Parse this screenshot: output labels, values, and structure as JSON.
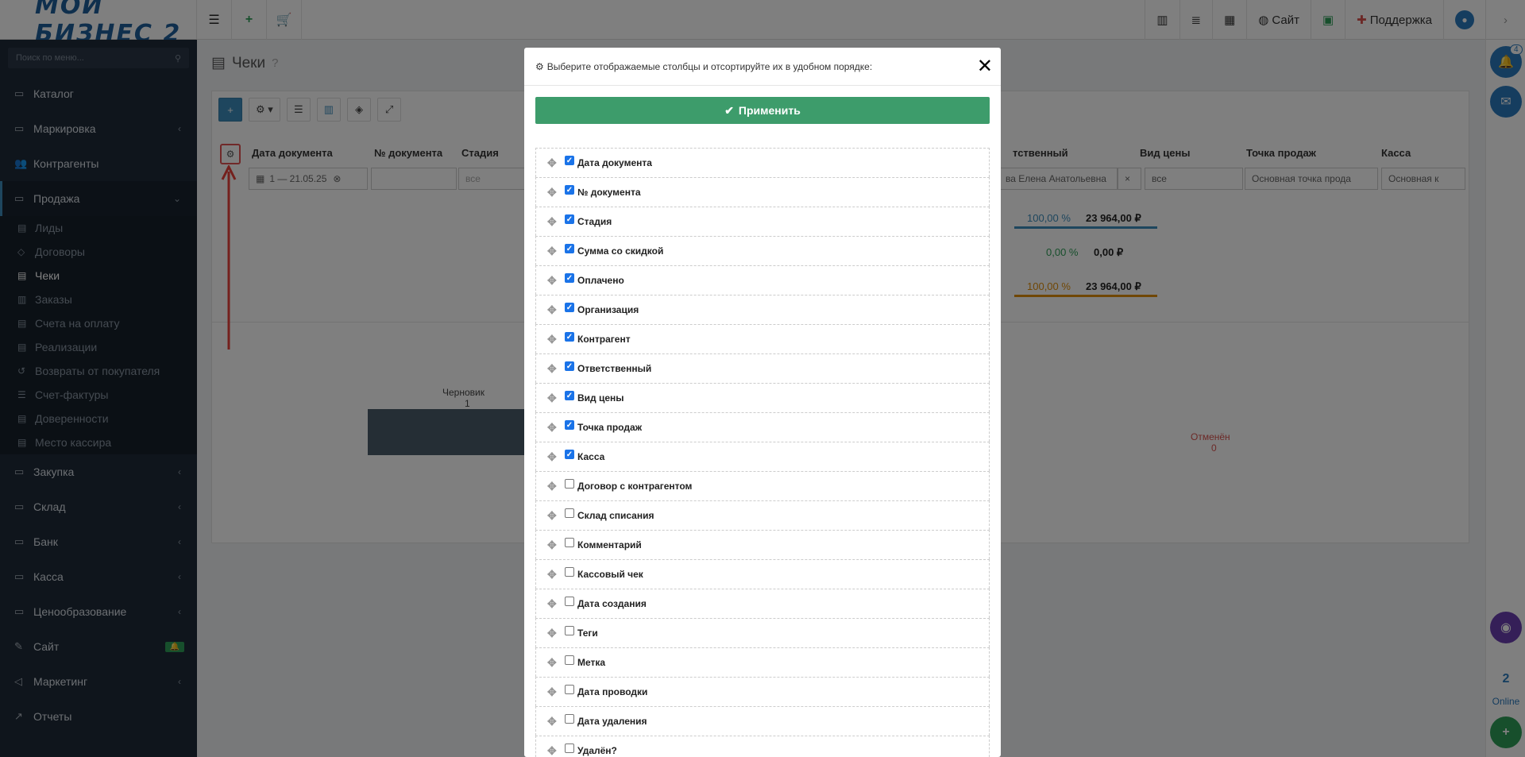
{
  "topbar": {
    "logo": "МОЙ БИЗНЕС 2",
    "site": "Сайт",
    "support": "Поддержка"
  },
  "sidebar": {
    "search_placeholder": "Поиск по меню...",
    "items": [
      {
        "label": "Каталог",
        "icon": "folder-icon",
        "chevron": false
      },
      {
        "label": "Маркировка",
        "icon": "folder-icon",
        "chevron": true
      },
      {
        "label": "Контрагенты",
        "icon": "users-icon",
        "chevron": false
      },
      {
        "label": "Продажа",
        "icon": "folder-icon",
        "chevron": true
      }
    ],
    "sub_items": [
      "Лиды",
      "Договоры",
      "Чеки",
      "Заказы",
      "Счета на оплату",
      "Реализации",
      "Возвраты от покупателя",
      "Счет-фактуры",
      "Доверенности",
      "Место кассира"
    ],
    "bottom_items": [
      {
        "label": "Закупка"
      },
      {
        "label": "Склад"
      },
      {
        "label": "Банк"
      },
      {
        "label": "Касса"
      },
      {
        "label": "Ценообразование"
      },
      {
        "label": "Сайт"
      },
      {
        "label": "Маркетинг"
      },
      {
        "label": "Отчеты"
      }
    ]
  },
  "content": {
    "page_title": "Чеки",
    "columns": {
      "date": "Дата документа",
      "number": "№ документа",
      "stage": "Стадия",
      "responsible": "тственный",
      "price_type": "Вид цены",
      "point": "Точка продаж",
      "cash": "Касса"
    },
    "filters": {
      "date": "1 — 21.05.25",
      "stage": "все",
      "responsible": "ва Елена Анатольевна",
      "price_type": "все",
      "point": "Основная точка прода",
      "cash": "Основная к"
    },
    "stats": [
      {
        "pct": "100,00 %",
        "sum": "23 964,00 ₽"
      },
      {
        "pct": "0,00 %",
        "sum": "0,00 ₽"
      },
      {
        "pct": "100,00 %",
        "sum": "23 964,00 ₽"
      }
    ],
    "chart": {
      "draft_label": "Черновик",
      "draft_value": "1",
      "cancel_label": "Отменён",
      "cancel_value": "0"
    }
  },
  "rail": {
    "notif_count": "4",
    "online_count": "2",
    "online_label": "Online"
  },
  "modal": {
    "title": "Выберите отображаемые столбцы и отсортируйте их в удобном порядке:",
    "apply": "Применить",
    "rows": [
      {
        "label": "Дата документа",
        "checked": true
      },
      {
        "label": "№ документа",
        "checked": true
      },
      {
        "label": "Стадия",
        "checked": true
      },
      {
        "label": "Сумма со скидкой",
        "checked": true
      },
      {
        "label": "Оплачено",
        "checked": true
      },
      {
        "label": "Организация",
        "checked": true
      },
      {
        "label": "Контрагент",
        "checked": true
      },
      {
        "label": "Ответственный",
        "checked": true
      },
      {
        "label": "Вид цены",
        "checked": true
      },
      {
        "label": "Точка продаж",
        "checked": true
      },
      {
        "label": "Касса",
        "checked": true
      },
      {
        "label": "Договор с контрагентом",
        "checked": false
      },
      {
        "label": "Склад списания",
        "checked": false
      },
      {
        "label": "Комментарий",
        "checked": false
      },
      {
        "label": "Кассовый чек",
        "checked": false
      },
      {
        "label": "Дата создания",
        "checked": false
      },
      {
        "label": "Теги",
        "checked": false
      },
      {
        "label": "Метка",
        "checked": false
      },
      {
        "label": "Дата проводки",
        "checked": false
      },
      {
        "label": "Дата удаления",
        "checked": false
      },
      {
        "label": "Удалён?",
        "checked": false
      }
    ]
  }
}
